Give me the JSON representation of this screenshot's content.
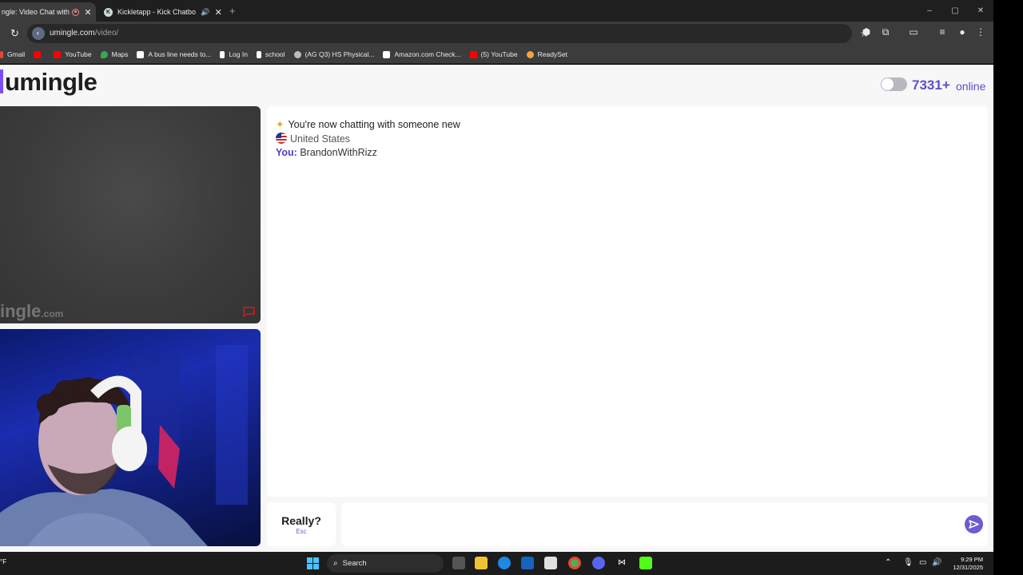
{
  "browser": {
    "tabs": [
      {
        "title": "ngle: Video Chat with S",
        "active": true
      },
      {
        "title": "Kickletapp - Kick Chatbot a",
        "active": false
      }
    ],
    "new_tab": "+",
    "window_controls": [
      "–",
      "▢",
      "✕"
    ],
    "url_domain": "umingle.com",
    "url_path": "/video/",
    "bookmarks": [
      {
        "label": "Gmail",
        "icon": "gmail-icon",
        "color": "#ea4335"
      },
      {
        "label": "",
        "icon": "youtube-icon",
        "color": "#ff0000"
      },
      {
        "label": "YouTube",
        "icon": "youtube-icon",
        "color": "#ff0000"
      },
      {
        "label": "Maps",
        "icon": "maps-icon",
        "color": "#34a853"
      },
      {
        "label": "A bus line needs to...",
        "icon": "bookmark-icon",
        "color": "#ffffff"
      },
      {
        "label": "Log In",
        "icon": "bookmark-icon",
        "color": "#ffffff"
      },
      {
        "label": "school",
        "icon": "bookmark-icon",
        "color": "#ffffff"
      },
      {
        "label": "(AG Q3) HS Physical...",
        "icon": "globe-icon",
        "color": "#bdbdbd"
      },
      {
        "label": "Amazon.com Check...",
        "icon": "amazon-icon",
        "color": "#ffffff"
      },
      {
        "label": "(5) YouTube",
        "icon": "youtube-icon",
        "color": "#ff0000"
      },
      {
        "label": "ReadySet",
        "icon": "readyset-icon",
        "color": "#f4a53a"
      }
    ]
  },
  "site": {
    "logo": "umingle",
    "online_count": "7331+",
    "online_label": "online",
    "watermark_main": "ingle",
    "watermark_suffix": ".com",
    "accent": "#5b4fc9"
  },
  "chat": {
    "system_message": "You're now chatting with someone new",
    "country": "United States",
    "you_label": "You:",
    "you_message": "BrandonWithRizz"
  },
  "controls": {
    "skip_label": "Really?",
    "skip_hint": "Esc",
    "message_placeholder": ""
  },
  "taskbar": {
    "temp": "°F",
    "search_label": "Search",
    "time": "9:29 PM",
    "date": "12/31/2025"
  }
}
